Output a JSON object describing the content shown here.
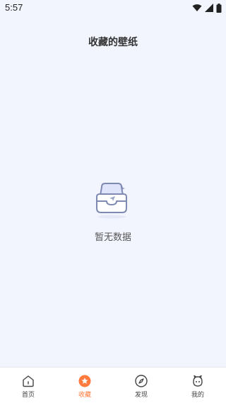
{
  "status_bar": {
    "time": "5:57",
    "icons": [
      "wifi-icon",
      "signal-icon",
      "battery-icon"
    ]
  },
  "header": {
    "title": "收藏的壁纸"
  },
  "empty_state": {
    "icon": "empty-inbox-icon",
    "message": "暂无数据"
  },
  "tab_bar": {
    "active_color": "#ff7a3c",
    "items": [
      {
        "label": "首页",
        "icon": "home-icon"
      },
      {
        "label": "收藏",
        "icon": "star-icon",
        "active": true
      },
      {
        "label": "发现",
        "icon": "compass-icon"
      },
      {
        "label": "我的",
        "icon": "profile-face-icon"
      }
    ]
  }
}
